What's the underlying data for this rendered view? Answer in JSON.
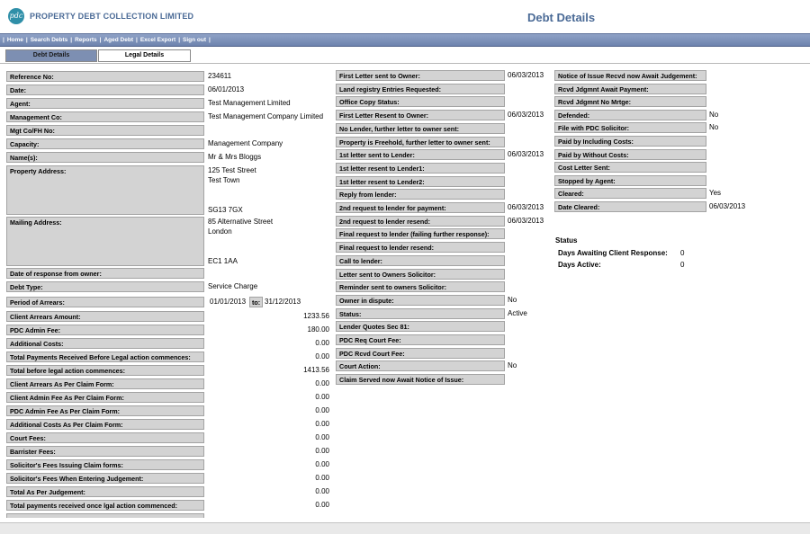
{
  "header": {
    "logo_text": "pdc",
    "company": "PROPERTY DEBT COLLECTION LIMITED",
    "title": "Debt Details"
  },
  "nav": [
    "Home",
    "Search Debts",
    "Reports",
    "Aged Debt",
    "Excel Export",
    "Sign out"
  ],
  "tabs": [
    "Debt Details",
    "Legal Details"
  ],
  "col1": [
    {
      "label": "Reference No:",
      "value": "234611"
    },
    {
      "label": "Date:",
      "value": "06/01/2013"
    },
    {
      "label": "Agent:",
      "value": "Test Management Limited"
    },
    {
      "label": "Management Co:",
      "value": "Test Management Company Limited"
    },
    {
      "label": "Mgt Co/FH No:",
      "value": ""
    },
    {
      "label": "Capacity:",
      "value": "Management Company"
    },
    {
      "label": "Name(s):",
      "value": "Mr & Mrs Bloggs"
    }
  ],
  "property": {
    "label": "Property Address:",
    "lines": [
      "125 Test Street",
      "Test Town",
      "",
      "",
      "SG13 7GX"
    ]
  },
  "mailing": {
    "label": "Mailing Address:",
    "lines": [
      "85 Alternative Street",
      "London",
      "",
      "",
      "EC1 1AA"
    ]
  },
  "col1b": [
    {
      "label": "Date of response from owner:",
      "value": ""
    },
    {
      "label": "Debt Type:",
      "value": "Service Charge"
    }
  ],
  "arrears": {
    "label": "Period of Arrears:",
    "from": "01/01/2013",
    "to_label": "to:",
    "to": "31/12/2013"
  },
  "amounts": [
    {
      "label": "Client Arrears Amount:",
      "value": "1233.56"
    },
    {
      "label": "PDC Admin Fee:",
      "value": "180.00"
    },
    {
      "label": "Additional Costs:",
      "value": "0.00"
    },
    {
      "label": "Total Payments Received Before Legal action commences:",
      "value": "0.00"
    },
    {
      "label": "Total before legal action commences:",
      "value": "1413.56"
    },
    {
      "label": "Client Arrears As Per Claim Form:",
      "value": "0.00"
    },
    {
      "label": "Client Admin Fee As Per Claim Form:",
      "value": "0.00"
    },
    {
      "label": "PDC Admin Fee As Per Claim Form:",
      "value": "0.00"
    },
    {
      "label": "Additional Costs As Per Claim Form:",
      "value": "0.00"
    },
    {
      "label": "Court Fees:",
      "value": "0.00"
    },
    {
      "label": "Barrister Fees:",
      "value": "0.00"
    },
    {
      "label": "Solicitor's Fees Issuing Claim forms:",
      "value": "0.00"
    },
    {
      "label": "Solicitor's Fees When Entering Judgement:",
      "value": "0.00"
    },
    {
      "label": "Total As Per Judgement:",
      "value": "0.00"
    },
    {
      "label": "Total payments received once lgal action commenced:",
      "value": "0.00"
    }
  ],
  "col2": [
    {
      "label": "First Letter sent to Owner:",
      "value": "06/03/2013"
    },
    {
      "label": "Land registry Entries Requested:",
      "value": ""
    },
    {
      "label": "Office Copy Status:",
      "value": ""
    },
    {
      "label": "First Letter Resent to Owner:",
      "value": "06/03/2013"
    },
    {
      "label": "No Lender, further letter to owner sent:",
      "value": ""
    },
    {
      "label": "Property is Freehold, further letter to owner sent:",
      "value": ""
    },
    {
      "label": "1st letter sent to Lender:",
      "value": "06/03/2013"
    },
    {
      "label": "1st letter resent to Lender1:",
      "value": ""
    },
    {
      "label": "1st letter resent to Lender2:",
      "value": ""
    },
    {
      "label": "Reply from lender:",
      "value": ""
    },
    {
      "label": "2nd request to lender for payment:",
      "value": "06/03/2013"
    },
    {
      "label": "2nd request to lender resend:",
      "value": "06/03/2013"
    },
    {
      "label": "Final request to lender (failing further response):",
      "value": ""
    },
    {
      "label": "Final request to lender resend:",
      "value": ""
    },
    {
      "label": "Call to lender:",
      "value": ""
    },
    {
      "label": "Letter sent to Owners Solicitor:",
      "value": ""
    },
    {
      "label": "Reminder sent to owners Solicitor:",
      "value": ""
    },
    {
      "label": "Owner in dispute:",
      "value": "No"
    },
    {
      "label": "Status:",
      "value": "Active"
    },
    {
      "label": "Lender Quotes Sec 81:",
      "value": ""
    },
    {
      "label": "PDC Req Court Fee:",
      "value": ""
    },
    {
      "label": "PDC Rcvd Court Fee:",
      "value": ""
    },
    {
      "label": "Court Action:",
      "value": "No"
    },
    {
      "label": "Claim Served now Await Notice of Issue:",
      "value": ""
    }
  ],
  "col3": [
    {
      "label": "Notice of Issue Recvd now Await Judgement:",
      "value": ""
    },
    {
      "label": "Rcvd Jdgmnt Await Payment:",
      "value": ""
    },
    {
      "label": "Rcvd Jdgmnt No Mrtge:",
      "value": ""
    },
    {
      "label": "Defended:",
      "value": "No"
    },
    {
      "label": "File with PDC Solicitor:",
      "value": "No"
    },
    {
      "label": "Paid by Including Costs:",
      "value": ""
    },
    {
      "label": "Paid by Without Costs:",
      "value": ""
    },
    {
      "label": "Cost Letter Sent:",
      "value": ""
    },
    {
      "label": "Stopped by Agent:",
      "value": ""
    },
    {
      "label": "Cleared:",
      "value": "Yes"
    },
    {
      "label": "Date Cleared:",
      "value": "06/03/2013"
    }
  ],
  "status": {
    "title": "Status",
    "awaiting_label": "Days Awaiting Client Response:",
    "awaiting_value": "0",
    "active_label": "Days Active:",
    "active_value": "0"
  },
  "colors": {
    "nav_bg": "#7b8fb8",
    "label_bg": "#d3d3d3",
    "title": "#4a6a96"
  }
}
